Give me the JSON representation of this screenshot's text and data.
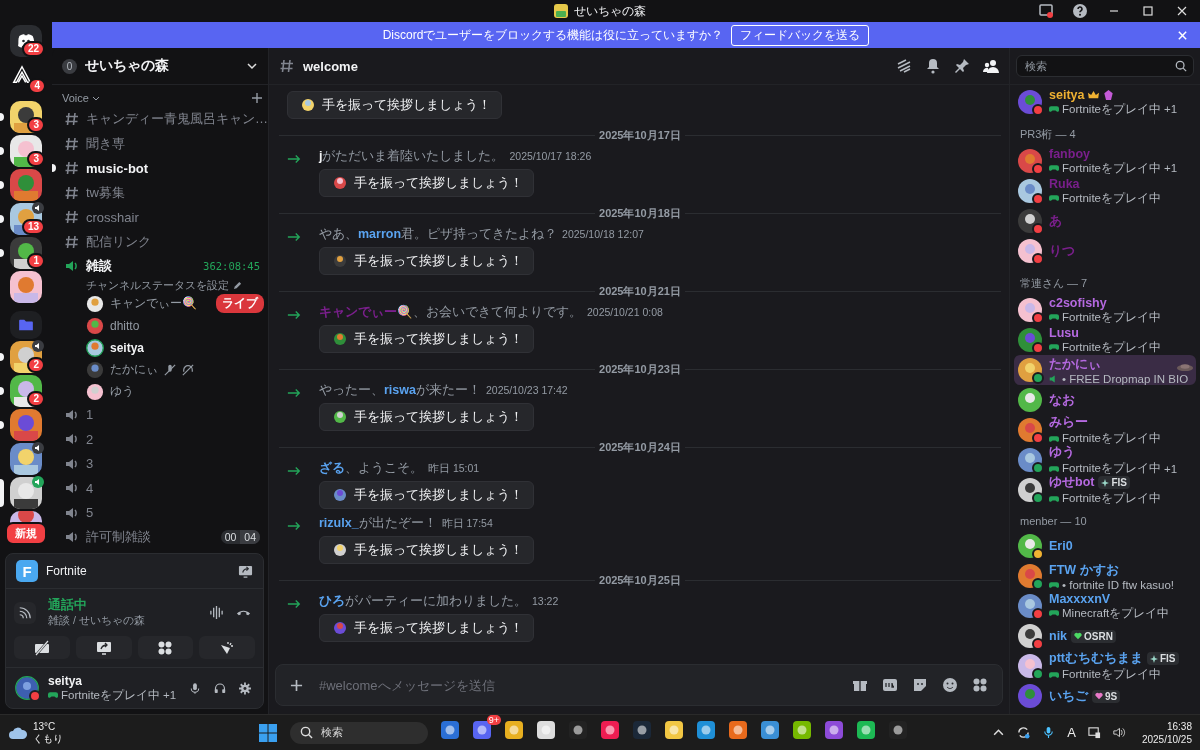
{
  "window": {
    "title": "せいちゃの森"
  },
  "banner": {
    "text": "Discordでユーザーをブロックする機能は役に立っていますか？",
    "button": "フィードバックを送る"
  },
  "servers": [
    {
      "kind": "home",
      "badge": "22",
      "unread": false,
      "selected": false,
      "voice": false
    },
    {
      "kind": "logo",
      "badge": "4",
      "unread": false,
      "selected": false,
      "voice": false
    },
    {
      "kind": "server",
      "badge": "3",
      "unread": true,
      "selected": false,
      "voice": false
    },
    {
      "kind": "server",
      "badge": "3",
      "unread": true,
      "selected": false,
      "voice": false
    },
    {
      "kind": "server",
      "unread": true,
      "selected": false,
      "voice": false
    },
    {
      "kind": "server",
      "badge": "13",
      "unread": true,
      "selected": false,
      "voice": true
    },
    {
      "kind": "server",
      "badge": "1",
      "unread": true,
      "selected": false,
      "voice": false
    },
    {
      "kind": "server",
      "unread": false,
      "selected": false,
      "voice": false
    },
    {
      "kind": "folder",
      "unread": false,
      "selected": false,
      "voice": false
    },
    {
      "kind": "server",
      "badge": "2",
      "unread": true,
      "selected": false,
      "voice": true
    },
    {
      "kind": "server",
      "badge": "2",
      "unread": true,
      "selected": false,
      "voice": false
    },
    {
      "kind": "server",
      "unread": true,
      "selected": false,
      "voice": false
    },
    {
      "kind": "server",
      "unread": false,
      "selected": false,
      "voice": true
    },
    {
      "kind": "server",
      "unread": false,
      "selected": true,
      "voice": true
    },
    {
      "kind": "server",
      "badge": "新規",
      "unread": false,
      "selected": false,
      "voice": false
    }
  ],
  "guild": {
    "name": "せいちゃの森",
    "boost": "0",
    "category": "Voice"
  },
  "channels": [
    {
      "kind": "text",
      "name": "キャンディー青鬼風呂キャン…",
      "unread": false
    },
    {
      "kind": "text",
      "name": "聞き専",
      "unread": false
    },
    {
      "kind": "text",
      "name": "music-bot",
      "unread": true
    },
    {
      "kind": "text",
      "name": "tw募集",
      "unread": false
    },
    {
      "kind": "text",
      "name": "crosshair",
      "unread": false
    },
    {
      "kind": "text",
      "name": "配信リンク",
      "unread": false
    },
    {
      "kind": "voice",
      "name": "雑談",
      "unread": true,
      "connected": true,
      "timer": "362:08:45",
      "status": "チャンネルステータスを設定",
      "users": [
        {
          "name": "キャンでぃー🍭",
          "live": "ライブ",
          "speaking": false,
          "muted": false
        },
        {
          "name": "dhitto",
          "speaking": false,
          "muted": false
        },
        {
          "name": "seitya",
          "speaking": true,
          "muted": false
        },
        {
          "name": "たかにぃ",
          "speaking": false,
          "muted": true
        },
        {
          "name": "ゆう",
          "speaking": false,
          "muted": false
        }
      ]
    },
    {
      "kind": "voice",
      "name": "1",
      "unread": false,
      "connected": false
    },
    {
      "kind": "voice",
      "name": "2",
      "unread": false,
      "connected": false
    },
    {
      "kind": "voice",
      "name": "3",
      "unread": false,
      "connected": false
    },
    {
      "kind": "voice",
      "name": "4",
      "unread": false,
      "connected": false
    },
    {
      "kind": "voice",
      "name": "5",
      "unread": false,
      "connected": false
    },
    {
      "kind": "voice",
      "name": "許可制雑談",
      "unread": false,
      "connected": false,
      "limit": [
        "00",
        "04"
      ]
    }
  ],
  "voice_panel": {
    "game": "Fortnite",
    "game_letter": "F",
    "state": "通話中",
    "location": "雑談 / せいちゃの森"
  },
  "user": {
    "name": "seitya",
    "activity": "Fortniteをプレイ中",
    "extra": "+1",
    "status_dot": {
      "color": "#f23f43"
    }
  },
  "channel": {
    "name": "welcome"
  },
  "messages": [
    {
      "kind": "join",
      "button": "手を振って挨拶しましょう！"
    },
    {
      "kind": "date",
      "text": "2025年10月17日"
    },
    {
      "kind": "join",
      "segments": [
        {
          "kind": "name",
          "text": "j",
          "color": "#f2f3f5"
        },
        {
          "kind": "plain",
          "text": "がただいま着陸いたしました。"
        }
      ],
      "time": "2025/10/17 18:26",
      "button": "手を振って挨拶しましょう！"
    },
    {
      "kind": "date",
      "text": "2025年10月18日"
    },
    {
      "kind": "join",
      "segments": [
        {
          "kind": "plain",
          "text": "やあ、"
        },
        {
          "kind": "name",
          "text": "marron",
          "color": "#5aa3f0"
        },
        {
          "kind": "plain",
          "text": "君。ピザ持ってきたよね？"
        }
      ],
      "time": "2025/10/18 12:07",
      "button": "手を振って挨拶しましょう！"
    },
    {
      "kind": "date",
      "text": "2025年10月21日"
    },
    {
      "kind": "join",
      "segments": [
        {
          "kind": "name",
          "text": "キャンでぃー🍭",
          "color": "#7a1f8c"
        },
        {
          "kind": "plain",
          "text": "、お会いできて何よりです。"
        }
      ],
      "time": "2025/10/21 0:08",
      "button": "手を振って挨拶しましょう！"
    },
    {
      "kind": "date",
      "text": "2025年10月23日"
    },
    {
      "kind": "join",
      "segments": [
        {
          "kind": "plain",
          "text": "やったー、"
        },
        {
          "kind": "name",
          "text": "riswa",
          "color": "#5aa3f0"
        },
        {
          "kind": "plain",
          "text": "が来たー！"
        }
      ],
      "time": "2025/10/23 17:42",
      "button": "手を振って挨拶しましょう！"
    },
    {
      "kind": "date",
      "text": "2025年10月24日"
    },
    {
      "kind": "join",
      "segments": [
        {
          "kind": "name",
          "text": "ざる",
          "color": "#5aa3f0"
        },
        {
          "kind": "plain",
          "text": "、ようこそ。"
        }
      ],
      "time": "昨日 15:01",
      "button": "手を振って挨拶しましょう！"
    },
    {
      "kind": "join",
      "segments": [
        {
          "kind": "name",
          "text": "rizulx_",
          "color": "#5aa3f0"
        },
        {
          "kind": "plain",
          "text": "が出たぞー！"
        }
      ],
      "time": "昨日 17:54",
      "button": "手を振って挨拶しましょう！"
    },
    {
      "kind": "date",
      "text": "2025年10月25日"
    },
    {
      "kind": "join",
      "segments": [
        {
          "kind": "name",
          "text": "ひろ",
          "color": "#5aa3f0"
        },
        {
          "kind": "plain",
          "text": "がパーティーに加わりました。"
        }
      ],
      "time": "13:22",
      "button": "手を振って挨拶しましょう！"
    }
  ],
  "composer": {
    "placeholder": "#welcomeへメッセージを送信"
  },
  "member_search": {
    "placeholder": "検索"
  },
  "member_groups": [
    {
      "members": [
        {
          "name": "seitya",
          "color": "#f0b232",
          "status_dot": {
            "color": "#f23f43"
          },
          "owner": true,
          "activity": {
            "kind": "game",
            "text": "Fortniteをプレイ中"
          },
          "extra": "+1",
          "highlighted": false
        }
      ]
    },
    {
      "title": "PR3桁 — 4",
      "members": [
        {
          "name": "fanboy",
          "color": "#7a1f8c",
          "status_dot": {
            "color": "#f23f43"
          },
          "owner": false,
          "activity": {
            "kind": "game",
            "text": "Fortniteをプレイ中"
          },
          "extra": "+1",
          "highlighted": false
        },
        {
          "name": "Ruka",
          "color": "#7a1f8c",
          "status_dot": {
            "color": "#f23f43"
          },
          "owner": false,
          "activity": {
            "kind": "game",
            "text": "Fortniteをプレイ中"
          },
          "highlighted": false
        },
        {
          "name": "あ",
          "color": "#7a1f8c",
          "status_dot": {
            "color": "#f23f43"
          },
          "owner": false,
          "highlighted": false
        },
        {
          "name": "りつ",
          "color": "#7a1f8c",
          "status_dot": {
            "color": "#f23f43"
          },
          "owner": false,
          "highlighted": false
        }
      ]
    },
    {
      "title": "常連さん — 7",
      "members": [
        {
          "name": "c2sofishy",
          "color": "#b569e0",
          "status_dot": {
            "color": "#f23f43"
          },
          "owner": false,
          "activity": {
            "kind": "game",
            "text": "Fortniteをプレイ中"
          },
          "highlighted": false
        },
        {
          "name": "Lusu",
          "color": "#b569e0",
          "status_dot": {
            "color": "#f23f43"
          },
          "owner": false,
          "activity": {
            "kind": "game",
            "text": "Fortniteをプレイ中"
          },
          "highlighted": false
        },
        {
          "name": "たかにぃ",
          "color": "#b569e0",
          "status_dot": {
            "color": "#23a55a"
          },
          "owner": false,
          "activity": {
            "kind": "voice",
            "text": "• FREE Dropmap IN BIO"
          },
          "highlighted": true
        },
        {
          "name": "なお",
          "color": "#b569e0",
          "owner": false,
          "highlighted": false
        },
        {
          "name": "みらー",
          "color": "#b569e0",
          "status_dot": {
            "color": "#f23f43"
          },
          "owner": false,
          "activity": {
            "kind": "game",
            "text": "Fortniteをプレイ中"
          },
          "highlighted": false
        },
        {
          "name": "ゆう",
          "color": "#b569e0",
          "status_dot": {
            "color": "#23a55a"
          },
          "owner": false,
          "activity": {
            "kind": "game",
            "text": "Fortniteをプレイ中"
          },
          "extra": "+1",
          "highlighted": false
        },
        {
          "name": "ゆせbot",
          "color": "#b569e0",
          "status_dot": {
            "color": "#23a55a"
          },
          "owner": false,
          "tag": {
            "kind": "sparkle",
            "text": "FIS"
          },
          "activity": {
            "kind": "game",
            "text": "Fortniteをプレイ中"
          },
          "highlighted": false
        }
      ]
    },
    {
      "title": "menber — 10",
      "members": [
        {
          "name": "Eri0",
          "color": "#5aa3f0",
          "status_dot": {
            "color": "#f0b232"
          },
          "owner": false,
          "highlighted": false
        },
        {
          "name": "FTW かすお",
          "color": "#5aa3f0",
          "status_dot": {
            "color": "#23a55a"
          },
          "owner": false,
          "activity": {
            "kind": "game",
            "text": "• fortnite ID ftw kasuo!"
          },
          "highlighted": false
        },
        {
          "name": "MaxxxxnV",
          "color": "#5aa3f0",
          "status_dot": {
            "color": "#f23f43"
          },
          "owner": false,
          "activity": {
            "kind": "game",
            "text": "Minecraftをプレイ中"
          },
          "highlighted": false
        },
        {
          "name": "nik",
          "color": "#5aa3f0",
          "status_dot": {
            "color": "#f23f43"
          },
          "owner": false,
          "tag": {
            "kind": "heart",
            "text": "OSRN",
            "color": "#4cd964"
          },
          "highlighted": false
        },
        {
          "name": "pttむちむちまま",
          "color": "#5aa3f0",
          "status_dot": {
            "color": "#23a55a"
          },
          "owner": false,
          "tag": {
            "kind": "sparkle",
            "text": "FIS"
          },
          "activity": {
            "kind": "game",
            "text": "Fortniteをプレイ中"
          },
          "highlighted": false
        },
        {
          "name": "いちご",
          "color": "#5aa3f0",
          "owner": false,
          "tag": {
            "kind": "heart",
            "text": "9S",
            "color": "#e879c8"
          },
          "highlighted": false
        }
      ]
    }
  ],
  "taskbar": {
    "temperature": "13°C",
    "weather": "くもり",
    "search": "検索",
    "chat_badge": "9+",
    "ime": "A",
    "time": "16:38",
    "date": "2025/10/25"
  }
}
